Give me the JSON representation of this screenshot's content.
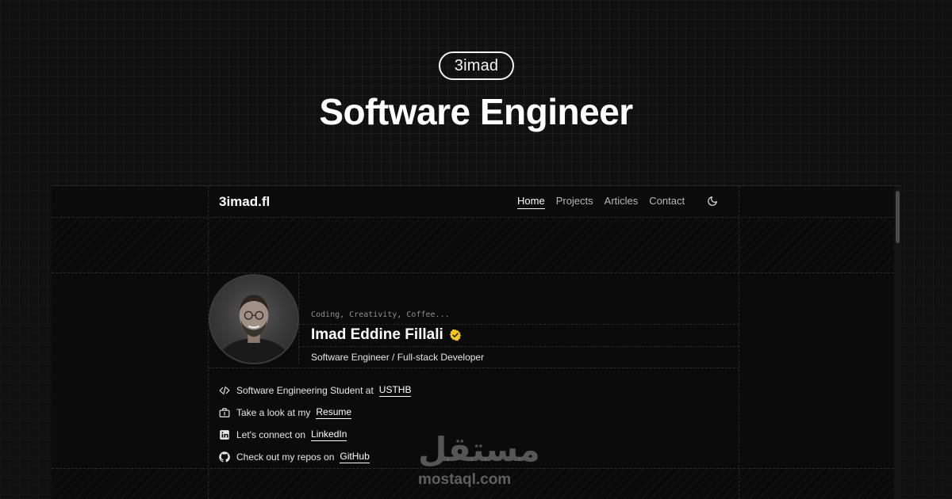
{
  "hero": {
    "brand": "3imad",
    "title": "Software Engineer"
  },
  "site": {
    "logo": "3imad.fl",
    "nav": [
      {
        "label": "Home",
        "active": true
      },
      {
        "label": "Projects",
        "active": false
      },
      {
        "label": "Articles",
        "active": false
      },
      {
        "label": "Contact",
        "active": false
      }
    ],
    "theme_toggle_icon": "moon-icon"
  },
  "profile": {
    "tagline": "Coding, Creativity, Coffee...",
    "name": "Imad Eddine Fillali",
    "verified_icon": "verified-badge-icon",
    "verified_color": "#f5c518",
    "role": "Software Engineer / Full-stack Developer"
  },
  "links": [
    {
      "icon": "code-icon",
      "text": "Software Engineering Student at",
      "link": "USTHB"
    },
    {
      "icon": "briefcase-icon",
      "text": "Take a look at my",
      "link": "Resume"
    },
    {
      "icon": "linkedin-icon",
      "text": "Let's connect on",
      "link": "LinkedIn"
    },
    {
      "icon": "github-icon",
      "text": "Check out my repos on",
      "link": "GitHub"
    }
  ],
  "watermark": {
    "logo": "مستقل",
    "domain": "mostaql.com"
  }
}
